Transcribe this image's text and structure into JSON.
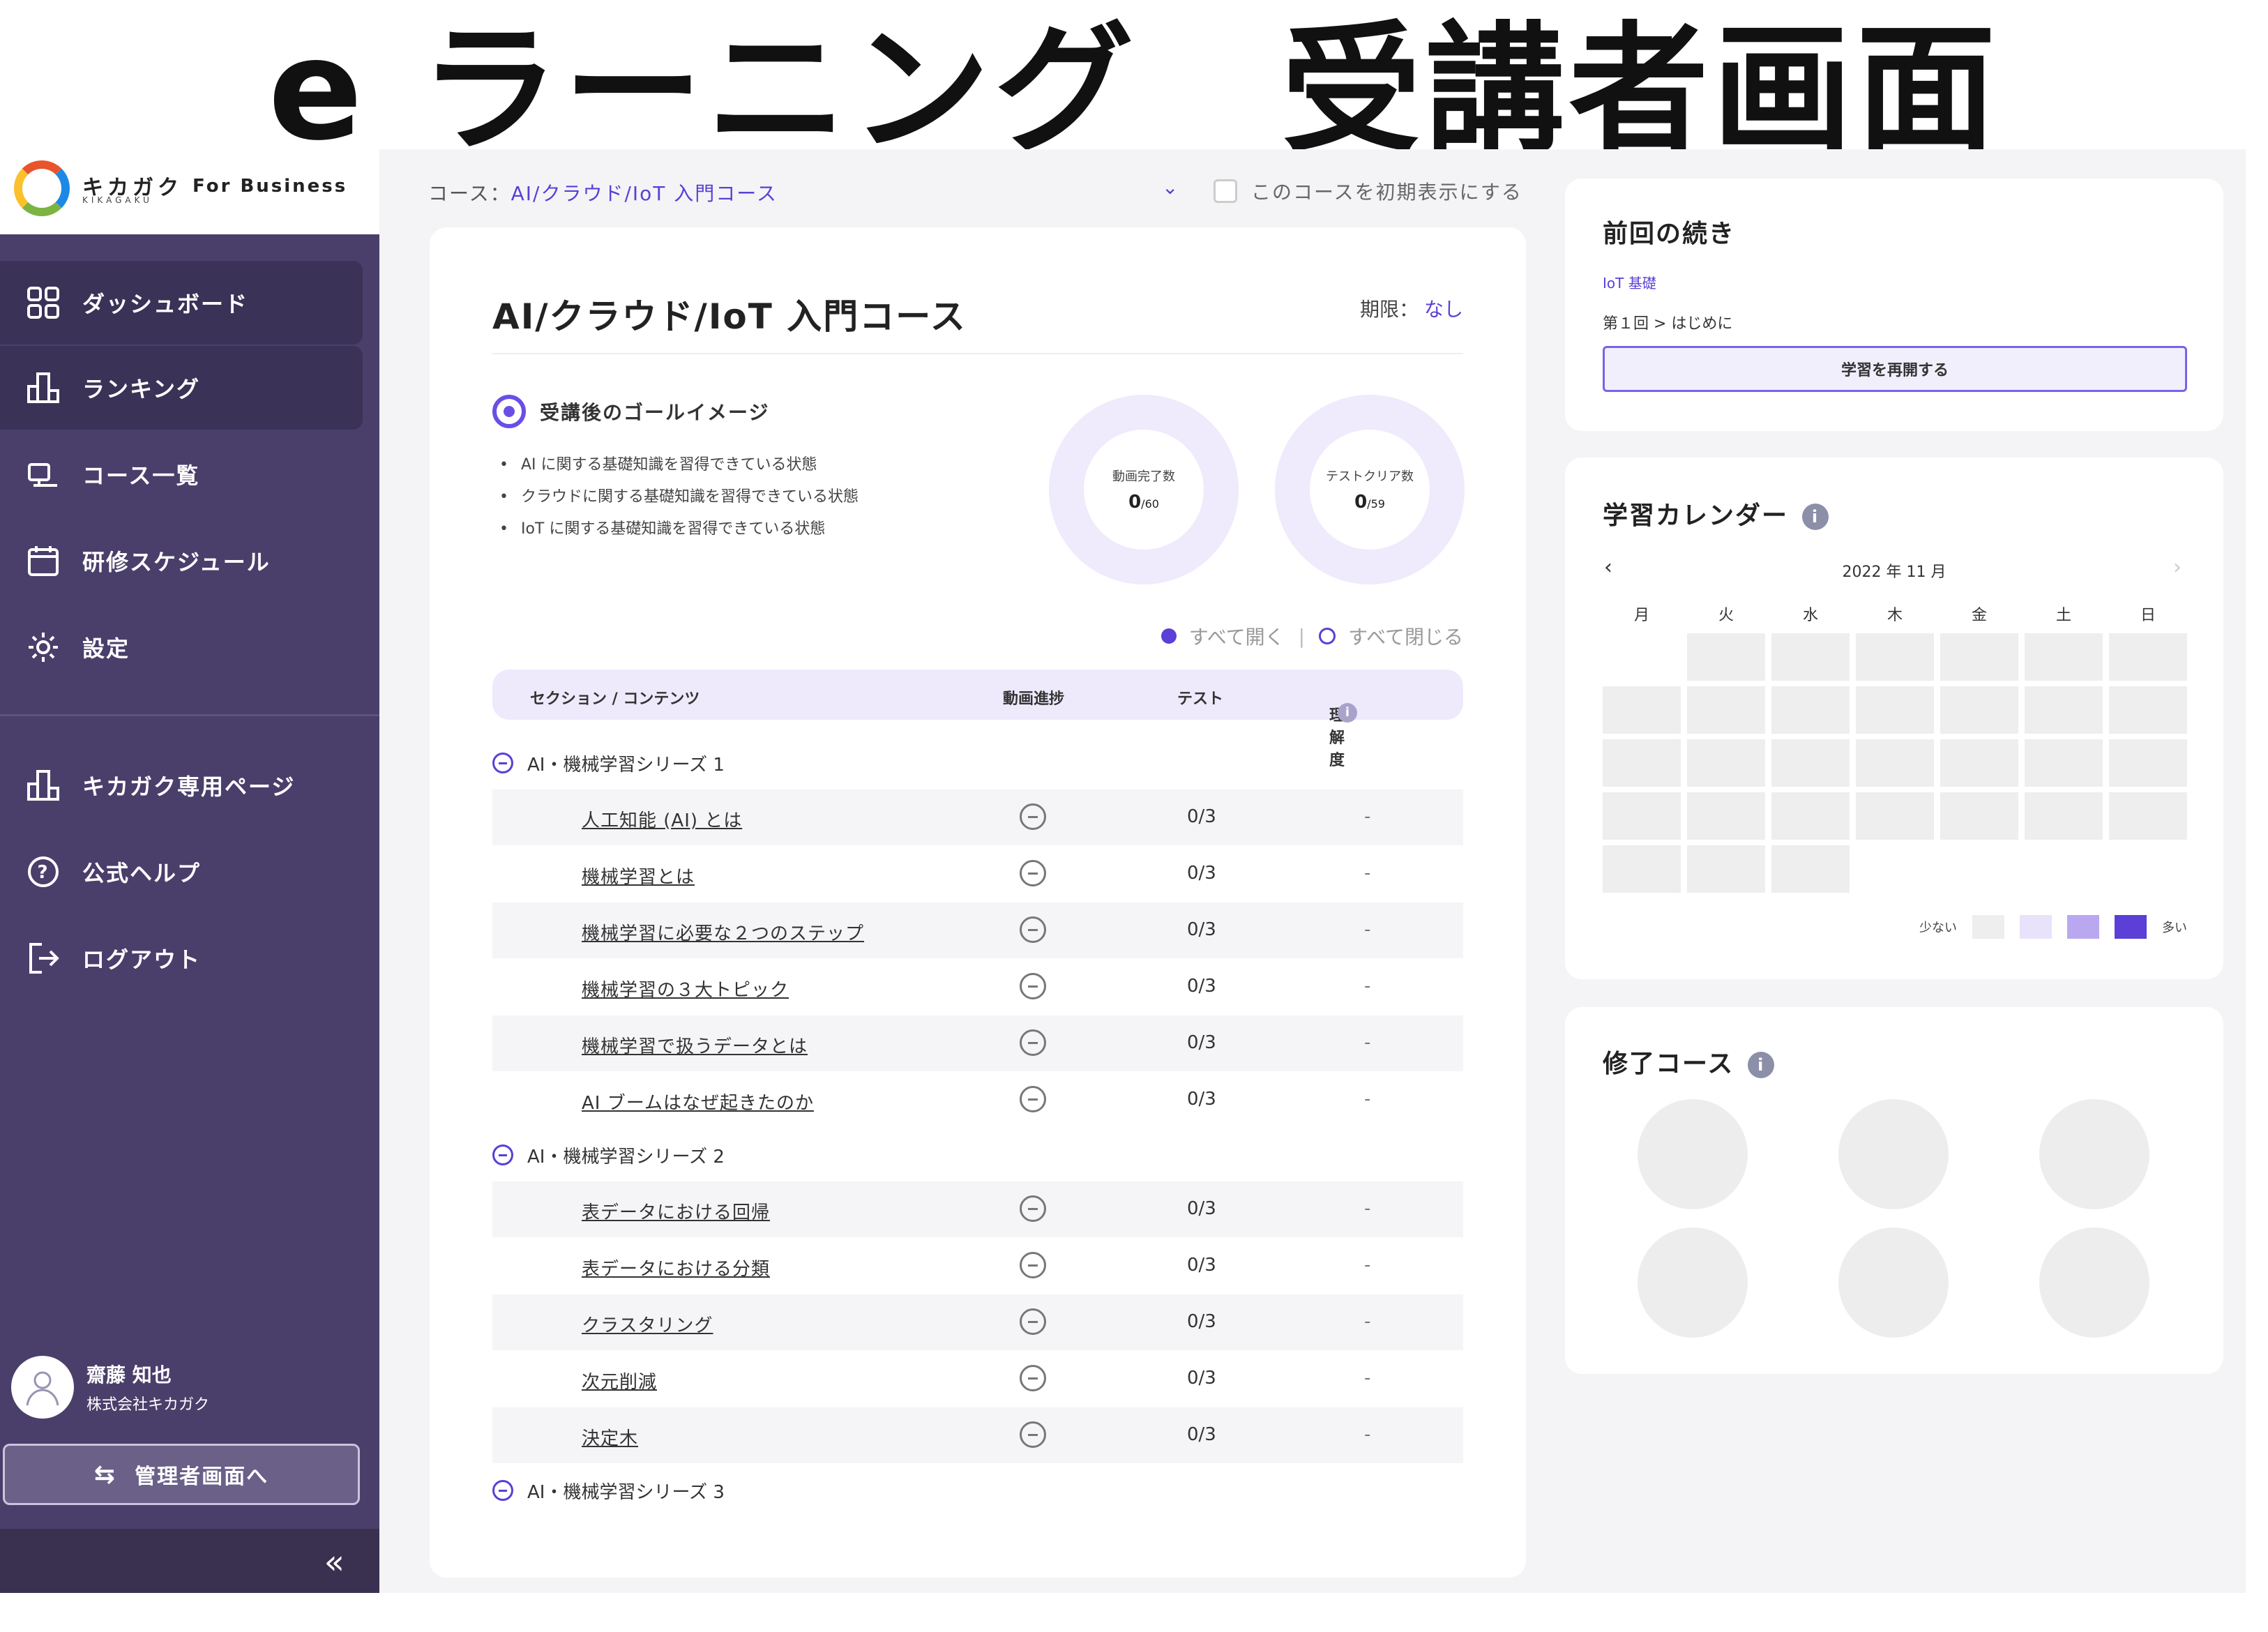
{
  "page_title": "e ラーニング　受講者画面",
  "logo": {
    "name": "キカガク",
    "sub": "KIKAGAKU",
    "for_business": "For Business"
  },
  "sidebar": {
    "items": [
      {
        "label": "ダッシュボード",
        "icon": "grid-icon"
      },
      {
        "label": "ランキング",
        "icon": "ranking-icon"
      },
      {
        "label": "コース一覧",
        "icon": "course-list-icon"
      },
      {
        "label": "研修スケジュール",
        "icon": "calendar-icon"
      },
      {
        "label": "設定",
        "icon": "gear-icon"
      }
    ],
    "links": [
      {
        "label": "キカガク専用ページ",
        "icon": "building-icon"
      },
      {
        "label": "公式ヘルプ",
        "icon": "help-icon"
      },
      {
        "label": "ログアウト",
        "icon": "logout-icon"
      }
    ],
    "user": {
      "name": "齋藤 知也",
      "org": "株式会社キカガク"
    },
    "admin_button": "管理者画面へ"
  },
  "course_selector": {
    "label": "コース：",
    "value": "AI/クラウド/IoT 入門コース",
    "default_checkbox": "このコースを初期表示にする"
  },
  "course": {
    "title": "AI/クラウド/IoT 入門コース",
    "deadline_label": "期限：",
    "deadline_value": "なし",
    "goal_heading": "受講後のゴールイメージ",
    "goals": [
      "AI に関する基礎知識を習得できている状態",
      "クラウドに関する基礎知識を習得できている状態",
      "IoT に関する基礎知識を習得できている状態"
    ],
    "stats": [
      {
        "label": "動画完了数",
        "value": "0",
        "total": "/60"
      },
      {
        "label": "テストクリア数",
        "value": "0",
        "total": "/59"
      }
    ],
    "expand_all": "すべて開く",
    "collapse_all": "すべて閉じる",
    "columns": {
      "section": "セクション / コンテンツ",
      "video": "動画進捗",
      "test": "テスト",
      "understanding": "理解度"
    },
    "sections": [
      {
        "title": "AI・機械学習シリーズ 1",
        "rows": [
          {
            "name": "人工知能 (AI) とは",
            "test": "0/3",
            "understanding": "-"
          },
          {
            "name": "機械学習とは",
            "test": "0/3",
            "understanding": "-"
          },
          {
            "name": "機械学習に必要な２つのステップ",
            "test": "0/3",
            "understanding": "-"
          },
          {
            "name": "機械学習の３大トピック",
            "test": "0/3",
            "understanding": "-"
          },
          {
            "name": "機械学習で扱うデータとは",
            "test": "0/3",
            "understanding": "-"
          },
          {
            "name": "AI ブームはなぜ起きたのか",
            "test": "0/3",
            "understanding": "-"
          }
        ]
      },
      {
        "title": "AI・機械学習シリーズ 2",
        "rows": [
          {
            "name": "表データにおける回帰",
            "test": "0/3",
            "understanding": "-"
          },
          {
            "name": "表データにおける分類",
            "test": "0/3",
            "understanding": "-"
          },
          {
            "name": "クラスタリング",
            "test": "0/3",
            "understanding": "-"
          },
          {
            "name": "次元削減",
            "test": "0/3",
            "understanding": "-"
          },
          {
            "name": "決定木",
            "test": "0/3",
            "understanding": "-"
          }
        ]
      },
      {
        "title": "AI・機械学習シリーズ 3",
        "rows": []
      }
    ]
  },
  "continue_card": {
    "title": "前回の続き",
    "category": "IoT 基礎",
    "chapter": "第１回 > はじめに",
    "button": "学習を再開する"
  },
  "calendar": {
    "title": "学習カレンダー",
    "month": "2022 年 11 月",
    "weekdays": [
      "月",
      "火",
      "水",
      "木",
      "金",
      "土",
      "日"
    ],
    "start_offset": 1,
    "days": 30,
    "legend_low": "少ない",
    "legend_high": "多い",
    "legend_colors": [
      "#eeeeee",
      "#e8e2fb",
      "#b9a8f0",
      "#5b3fd6"
    ]
  },
  "completed": {
    "title": "修了コース",
    "badge_count": 6
  },
  "colors": {
    "sidebar": "#4a3f6b",
    "accent": "#5b3fd6",
    "background": "#f4f4f6"
  }
}
